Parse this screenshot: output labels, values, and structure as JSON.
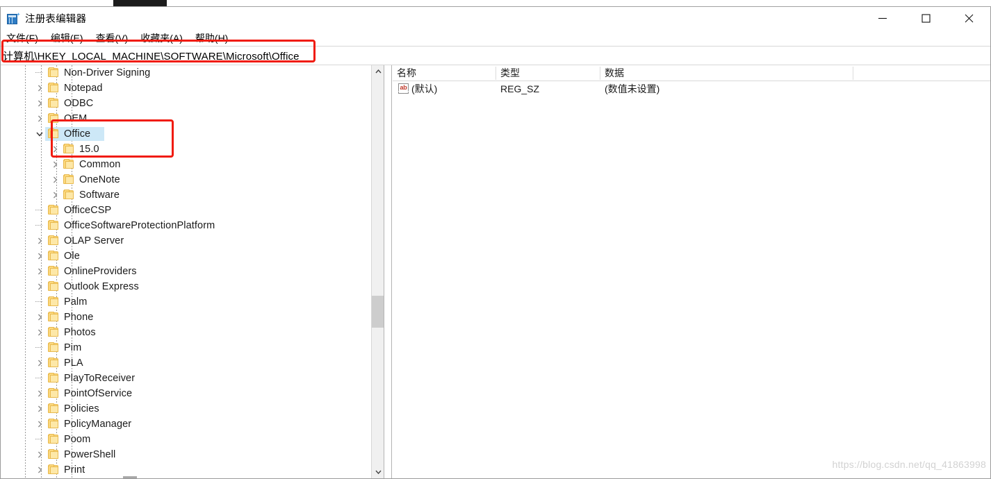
{
  "window": {
    "title": "注册表编辑器",
    "icon": "registry-editor-icon",
    "minimize_label": "—",
    "maximize_label": "□",
    "close_label": "✕"
  },
  "menu": {
    "items": [
      {
        "label": "文件(F)",
        "name": "menu-file"
      },
      {
        "label": "编辑(E)",
        "name": "menu-edit"
      },
      {
        "label": "查看(V)",
        "name": "menu-view"
      },
      {
        "label": "收藏夹(A)",
        "name": "menu-favorites"
      },
      {
        "label": "帮助(H)",
        "name": "menu-help"
      }
    ]
  },
  "address": {
    "value": "计算机\\HKEY_LOCAL_MACHINE\\SOFTWARE\\Microsoft\\Office",
    "placeholder": "计算机\\"
  },
  "tree": {
    "selected_key": "Office",
    "selection_color": "#cde8f7",
    "items": [
      {
        "label": "Non-Driver Signing",
        "depth": 3,
        "state": "leaf"
      },
      {
        "label": "Notepad",
        "depth": 3,
        "state": "collapsed"
      },
      {
        "label": "ODBC",
        "depth": 3,
        "state": "collapsed"
      },
      {
        "label": "OEM",
        "depth": 3,
        "state": "collapsed"
      },
      {
        "label": "Office",
        "depth": 3,
        "state": "expanded",
        "selected": true
      },
      {
        "label": "15.0",
        "depth": 4,
        "state": "collapsed"
      },
      {
        "label": "Common",
        "depth": 4,
        "state": "collapsed"
      },
      {
        "label": "OneNote",
        "depth": 4,
        "state": "collapsed"
      },
      {
        "label": "Software",
        "depth": 4,
        "state": "collapsed"
      },
      {
        "label": "OfficeCSP",
        "depth": 3,
        "state": "leaf"
      },
      {
        "label": "OfficeSoftwareProtectionPlatform",
        "depth": 3,
        "state": "leaf"
      },
      {
        "label": "OLAP Server",
        "depth": 3,
        "state": "collapsed"
      },
      {
        "label": "Ole",
        "depth": 3,
        "state": "collapsed"
      },
      {
        "label": "OnlineProviders",
        "depth": 3,
        "state": "collapsed"
      },
      {
        "label": "Outlook Express",
        "depth": 3,
        "state": "collapsed"
      },
      {
        "label": "Palm",
        "depth": 3,
        "state": "leaf"
      },
      {
        "label": "Phone",
        "depth": 3,
        "state": "collapsed"
      },
      {
        "label": "Photos",
        "depth": 3,
        "state": "collapsed"
      },
      {
        "label": "Pim",
        "depth": 3,
        "state": "leaf"
      },
      {
        "label": "PLA",
        "depth": 3,
        "state": "collapsed"
      },
      {
        "label": "PlayToReceiver",
        "depth": 3,
        "state": "leaf"
      },
      {
        "label": "PointOfService",
        "depth": 3,
        "state": "collapsed"
      },
      {
        "label": "Policies",
        "depth": 3,
        "state": "collapsed"
      },
      {
        "label": "PolicyManager",
        "depth": 3,
        "state": "collapsed"
      },
      {
        "label": "Poom",
        "depth": 3,
        "state": "leaf"
      },
      {
        "label": "PowerShell",
        "depth": 3,
        "state": "collapsed"
      },
      {
        "label": "Print",
        "depth": 3,
        "state": "collapsed"
      }
    ]
  },
  "values": {
    "columns": [
      "名称",
      "类型",
      "数据"
    ],
    "rows": [
      {
        "name": "(默认)",
        "type": "REG_SZ",
        "data": "(数值未设置)",
        "icon": "string-value-icon"
      }
    ]
  },
  "scrollbar": {
    "up_arrow": "chevron-up-icon",
    "down_arrow": "chevron-down-icon"
  },
  "watermark": {
    "text": "https://blog.csdn.net/qq_41863998"
  },
  "annotations": {
    "address_box_color": "#f01b0e",
    "office_box_color": "#f01b0e"
  }
}
